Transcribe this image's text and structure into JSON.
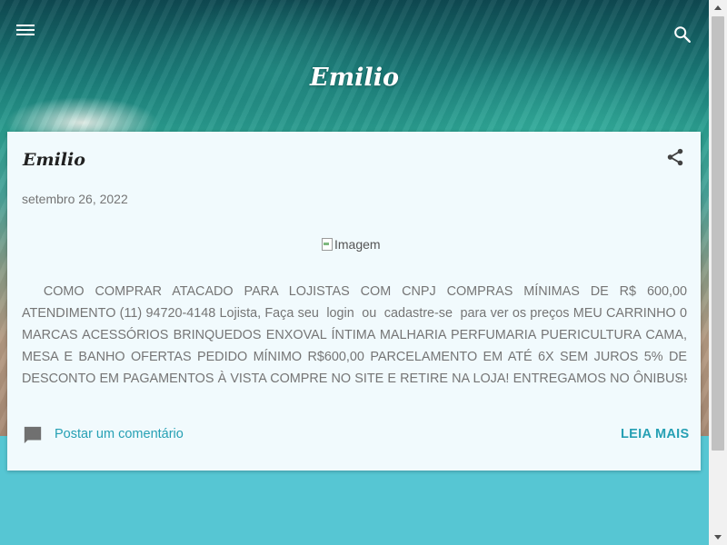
{
  "header": {
    "blog_title": "Emilio",
    "menu_icon": "hamburger-menu-icon",
    "search_icon": "search-icon"
  },
  "post": {
    "title": "Emilio",
    "date": "setembro 26, 2022",
    "image_alt": "Imagem",
    "snippet": "  COMO COMPRAR ATACADO PARA LOJISTAS COM CNPJ COMPRAS MÍNIMAS DE R$ 600,00 ATENDIMENTO (11) 94720-4148 Lojista, Faça seu  login  ou  cadastre-se  para ver os preços MEU CARRINHO 0 MARCAS ACESSÓRIOS BRINQUEDOS ENXOVAL ÍNTIMA MALHARIA PERFUMARIA PUERICULTURA CAMA, MESA E BANHO OFERTAS PEDIDO MÍNIMO R$600,00 PARCELAMENTO EM ATÉ 6X SEM JUROS 5% DE DESCONTO EM PAGAMENTOS À VISTA COMPRE NO SITE E RETIRE NA LOJA! ENTREGAMOS NO ÔNIBUS! (SERVIÇO",
    "ellipsis": "…",
    "share_icon": "share-icon",
    "comment_icon": "comment-icon",
    "comment_label": "Postar um comentário",
    "read_more_label": "LEIA MAIS"
  },
  "colors": {
    "accent": "#26a0b4",
    "card_background": "#f1fafd",
    "page_background": "#56c6d3"
  }
}
